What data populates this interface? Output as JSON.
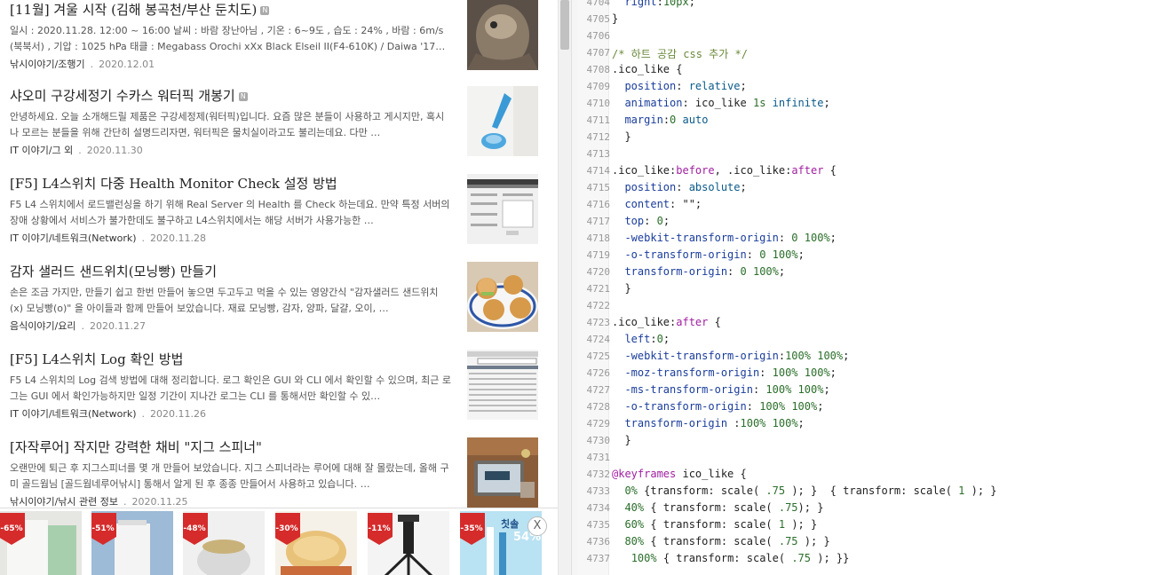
{
  "posts": [
    {
      "title": "[11월] 겨울 시작 (김해 봉곡천/부산 둔치도)",
      "excerpt": "일시 : 2020.11.28. 12:00 ~ 16:00 날씨 : 바람 장난아님 , 기온 : 6~9도 , 습도 : 24% , 바람 : 6m/s (북북서) , 기압 : 1025 hPa 태클 : Megabass Orochi xXx Black Elseil II(F4-610K) / Daiwa '17…",
      "category": "낚시이야기/조행기",
      "date": "2020.12.01",
      "has_new": true
    },
    {
      "title": "샤오미 구강세정기 수카스 워터픽 개봉기",
      "excerpt": "안녕하세요. 오늘 소개해드릴 제품은 구강세정제(워터픽)입니다. 요즘 많은 분들이 사용하고 게시지만, 혹시나 모르는 분들을 위해 간단히 설명드리자면, 워터픽은 물치실이라고도 불리는데요. 다만 …",
      "category": "IT 이야기/그 외",
      "date": "2020.11.30",
      "has_new": true
    },
    {
      "title": "[F5] L4스위치 다중 Health Monitor Check 설정 방법",
      "excerpt": "F5 L4 스위치에서 로드밸런싱을 하기 위해 Real Server 의 Health 를 Check 하는데요. 만약 특정 서버의 장애 상황에서 서비스가 불가한데도 불구하고 L4스위치에서는 해당 서버가 사용가능한 …",
      "category": "IT 이야기/네트워크(Network)",
      "date": "2020.11.28",
      "has_new": false
    },
    {
      "title": "감자 샐러드 샌드위치(모닝빵) 만들기",
      "excerpt": "손은 조금 가지만, 만들기 쉽고 한번 만들어 놓으면 두고두고 먹을 수 있는 영양간식 \"감자샐러드 샌드위치(x) 모닝빵(o)\" 을 아이들과 함께 만들어 보았습니다. 재료 모닝빵, 감자, 양파, 달걀, 오이, …",
      "category": "음식이야기/요리",
      "date": "2020.11.27",
      "has_new": false
    },
    {
      "title": "[F5] L4스위치 Log 확인 방법",
      "excerpt": "F5 L4 스위치의 Log 검색 방법에 대해 정리합니다. 로그 확인은 GUI 와 CLI 에서 확인할 수 있으며, 최근 로그는 GUI 에서 확인가능하지만 일정 기간이 지나간 로그는 CLI 를 통해서만 확인할 수 있…",
      "category": "IT 이야기/네트워크(Network)",
      "date": "2020.11.26",
      "has_new": false
    },
    {
      "title": "[자작루어] 작지만 강력한 채비 \"지그 스피너\"",
      "excerpt": "오랜만에 퇴근 후 지그스피너를 몇 개 만들어 보았습니다. 지그 스피너라는 루어에 대해 잘 몰랐는데, 올해 구미 골드웜님 [골드웜네루어낚시] 통해서 알게 된 후 종종 만들어서 사용하고 있습니다. …",
      "category": "낚시이야기/낚시 관련 정보",
      "date": "2020.11.25",
      "has_new": false
    }
  ],
  "ads": [
    {
      "discount": "-65%"
    },
    {
      "discount": "-51%"
    },
    {
      "discount": "-48%"
    },
    {
      "discount": "-30%"
    },
    {
      "discount": "-11%"
    },
    {
      "discount": "-35%",
      "overlay_text": "칫솔",
      "overlay_pct": "54%"
    }
  ],
  "ad_close_label": "X",
  "code_lines": [
    {
      "n": "4704",
      "t": "  right:10px;"
    },
    {
      "n": "4705",
      "t": "}"
    },
    {
      "n": "4706",
      "t": ""
    },
    {
      "n": "4707",
      "t": "/* 하트 공감 css 추가 */"
    },
    {
      "n": "4708",
      "t": ".ico_like {"
    },
    {
      "n": "4709",
      "t": "  position: relative;"
    },
    {
      "n": "4710",
      "t": "  animation: ico_like 1s infinite;"
    },
    {
      "n": "4711",
      "t": "  margin:0 auto"
    },
    {
      "n": "4712",
      "t": "  }"
    },
    {
      "n": "4713",
      "t": ""
    },
    {
      "n": "4714",
      "t": ".ico_like:before, .ico_like:after {"
    },
    {
      "n": "4715",
      "t": "  position: absolute;"
    },
    {
      "n": "4716",
      "t": "  content: \"\";"
    },
    {
      "n": "4717",
      "t": "  top: 0;"
    },
    {
      "n": "4718",
      "t": "  -webkit-transform-origin: 0 100%;"
    },
    {
      "n": "4719",
      "t": "  -o-transform-origin: 0 100%;"
    },
    {
      "n": "4720",
      "t": "  transform-origin: 0 100%;"
    },
    {
      "n": "4721",
      "t": "  }"
    },
    {
      "n": "4722",
      "t": ""
    },
    {
      "n": "4723",
      "t": ".ico_like:after {"
    },
    {
      "n": "4724",
      "t": "  left:0;"
    },
    {
      "n": "4725",
      "t": "  -webkit-transform-origin:100% 100%;"
    },
    {
      "n": "4726",
      "t": "  -moz-transform-origin: 100% 100%;"
    },
    {
      "n": "4727",
      "t": "  -ms-transform-origin: 100% 100%;"
    },
    {
      "n": "4728",
      "t": "  -o-transform-origin: 100% 100%;"
    },
    {
      "n": "4729",
      "t": "  transform-origin :100% 100%;"
    },
    {
      "n": "4730",
      "t": "  }"
    },
    {
      "n": "4731",
      "t": ""
    },
    {
      "n": "4732",
      "t": "@keyframes ico_like {"
    },
    {
      "n": "4733",
      "t": "  0% {transform: scale( .75 ); }  { transform: scale( 1 ); }"
    },
    {
      "n": "4734",
      "t": "  40% { transform: scale( .75); }"
    },
    {
      "n": "4735",
      "t": "  60% { transform: scale( 1 ); }"
    },
    {
      "n": "4736",
      "t": "  80% { transform: scale( .75 ); }"
    },
    {
      "n": "4737",
      "t": "   100% { transform: scale( .75 ); }}"
    }
  ],
  "colors": {
    "ad_badge": "#d52b2b",
    "comment": "#6a8a3a",
    "property": "#1a3d9c",
    "keyword": "#a020a0"
  }
}
